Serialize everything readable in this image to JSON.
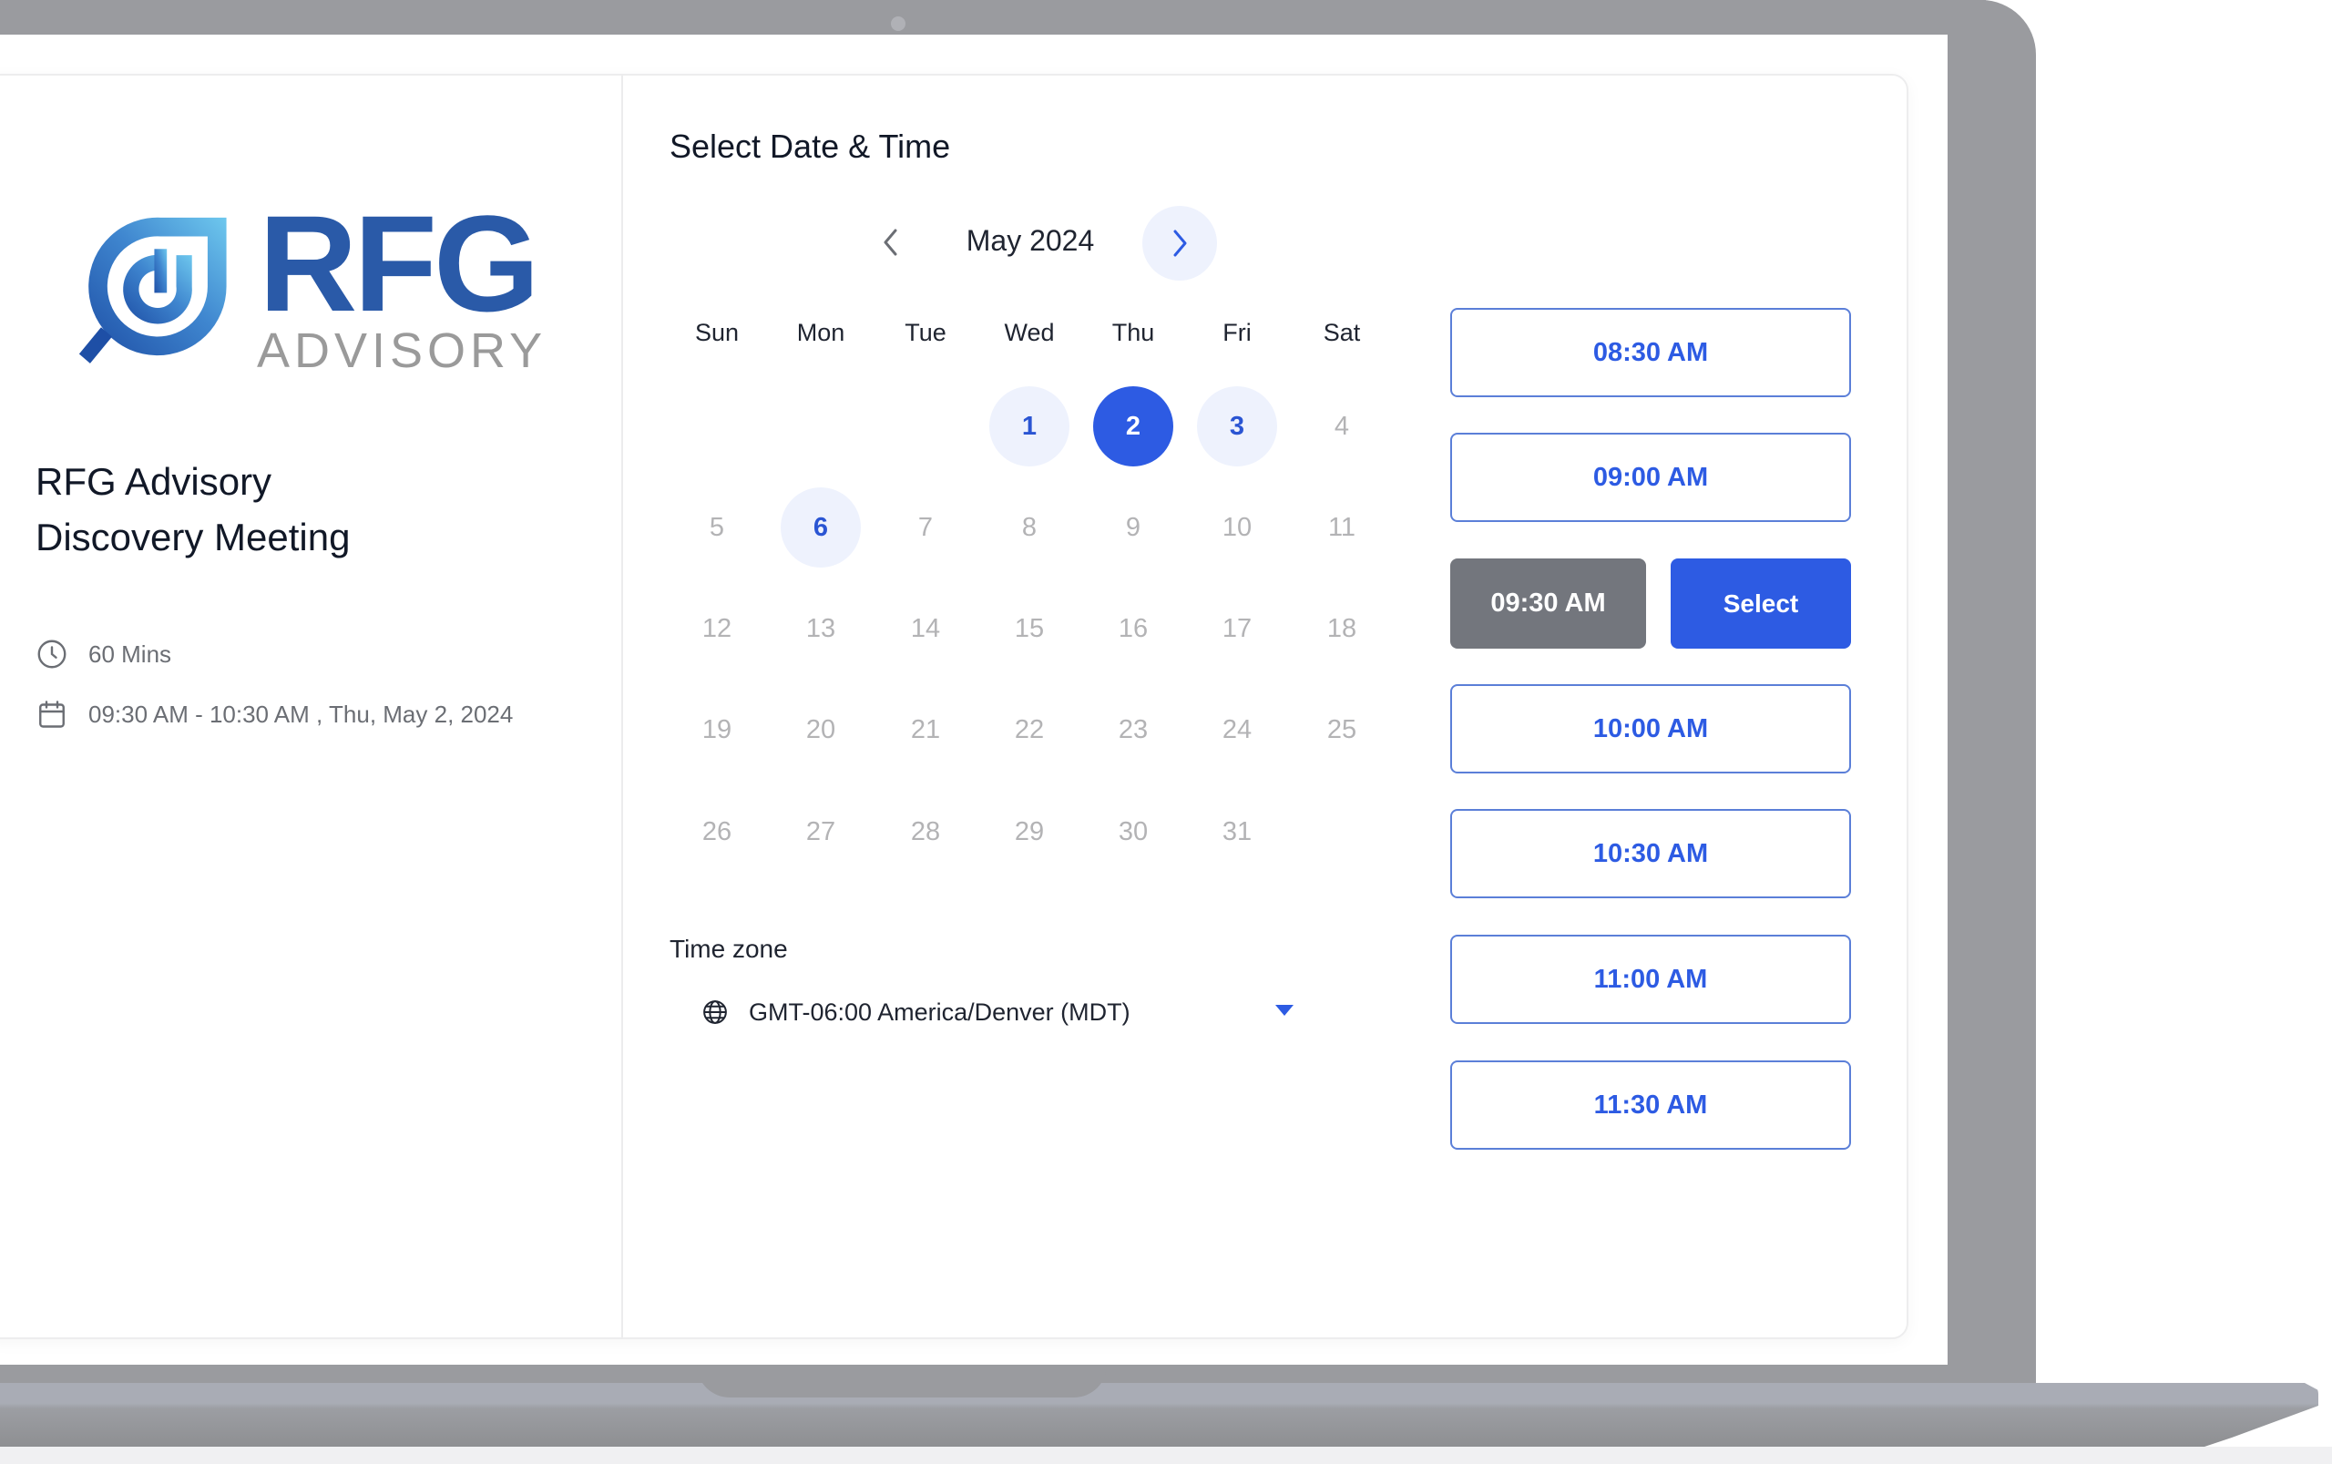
{
  "brand": {
    "logo_primary": "RFG",
    "logo_secondary": "ADVISORY",
    "primary_color": "#2d5be3",
    "logo_blue": "#2a5aa8",
    "logo_gray": "#9a9a9a"
  },
  "meeting": {
    "title_line1": "RFG Advisory",
    "title_line2": "Discovery Meeting",
    "duration": "60 Mins",
    "duration_icon": "clock-icon",
    "schedule": "09:30 AM - 10:30 AM , Thu, May 2, 2024",
    "schedule_icon": "calendar-icon"
  },
  "picker": {
    "title": "Select Date & Time",
    "month_label": "May 2024",
    "prev_icon": "chevron-left-icon",
    "next_icon": "chevron-right-icon",
    "weekdays": [
      "Sun",
      "Mon",
      "Tue",
      "Wed",
      "Thu",
      "Fri",
      "Sat"
    ],
    "first_weekday_index": 3,
    "days_in_month": 31,
    "available_days": [
      1,
      3,
      6
    ],
    "selected_day": 2
  },
  "timezone": {
    "label": "Time zone",
    "value": "GMT-06:00 America/Denver (MDT)",
    "icon": "globe-icon"
  },
  "slots": {
    "items": [
      {
        "label": "08:30 AM",
        "state": "available"
      },
      {
        "label": "09:00 AM",
        "state": "available"
      },
      {
        "label": "09:30 AM",
        "state": "chosen"
      },
      {
        "label": "10:00 AM",
        "state": "available"
      },
      {
        "label": "10:30 AM",
        "state": "available"
      },
      {
        "label": "11:00 AM",
        "state": "available"
      },
      {
        "label": "11:30 AM",
        "state": "available"
      }
    ],
    "select_label": "Select"
  }
}
